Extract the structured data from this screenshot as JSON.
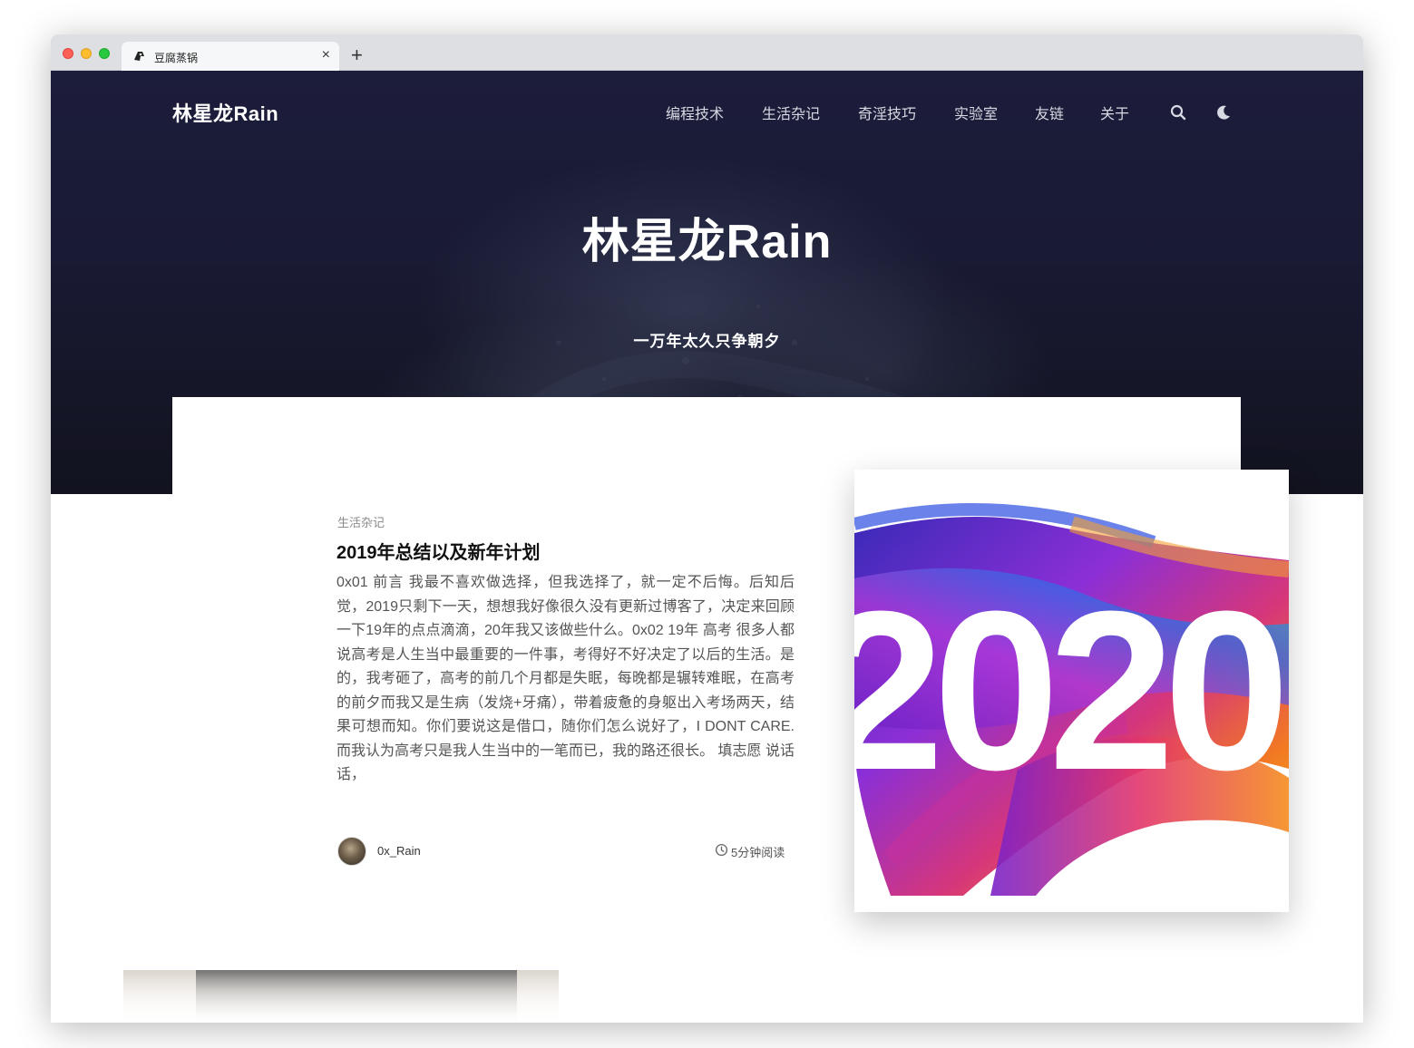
{
  "browser": {
    "tab_title": "豆腐蒸锅",
    "tab_close": "×",
    "new_tab": "+"
  },
  "site": {
    "logo": "林星龙Rain",
    "nav": [
      "编程技术",
      "生活杂记",
      "奇淫技巧",
      "实验室",
      "友链",
      "关于"
    ],
    "icons": [
      "search-icon",
      "moon-icon"
    ]
  },
  "hero": {
    "title": "林星龙Rain",
    "subtitle": "一万年太久只争朝夕"
  },
  "post": {
    "category": "生活杂记",
    "title": "2019年总结以及新年计划",
    "excerpt": "0x01 前言 我最不喜欢做选择，但我选择了，就一定不后悔。后知后觉，2019只剩下一天，想想我好像很久没有更新过博客了，决定来回顾一下19年的点点滴滴，20年我又该做些什么。0x02 19年 高考 很多人都说高考是人生当中最重要的一件事，考得好不好决定了以后的生活。是的，我考砸了，高考的前几个月都是失眠，每晚都是辗转难眠，在高考的前夕而我又是生病（发烧+牙痛），带着疲惫的身躯出入考场两天，结果可想而知。你们要说这是借口，随你们怎么说好了，I DONT CARE.而我认为高考只是我人生当中的一笔而已，我的路还很长。 填志愿 说话话，",
    "author": "0x_Rain",
    "read_time": "5分钟阅读",
    "image_text": "2020"
  },
  "colors": {
    "hero_dark": "#1c1d3b",
    "nav_text": "#d7d9e3"
  }
}
